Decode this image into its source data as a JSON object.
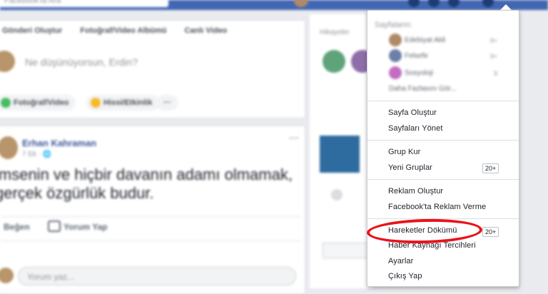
{
  "topbar": {
    "search_placeholder": "Facebook'ta Ara"
  },
  "composer": {
    "tabs": [
      "Gönderi Oluştur",
      "Fotoğraf/Video Albümü",
      "Canlı Video"
    ],
    "placeholder": "Ne düşünüyorsun, Erdin?",
    "buttons": [
      "Fotoğraf/Video",
      "Hissi/Etkinlik",
      "···"
    ]
  },
  "post": {
    "author": "Erhan Kahraman",
    "meta": "7 Ek · 🌐",
    "text_line1": "imsenin ve hiçbir davanın adamı olmamak,",
    "text_line2": "gerçek özgürlük budur.",
    "actions": [
      "Beğen",
      "Yorum Yap"
    ],
    "comment_placeholder": "Yorum yaz..."
  },
  "right_col": {
    "title": "Hikayeler"
  },
  "menu": {
    "section_title": "Sayfaların:",
    "accounts": [
      {
        "name": "Edebiyat Akli",
        "count": "9+"
      },
      {
        "name": "Felsefe",
        "count": "9+"
      },
      {
        "name": "Sosyoloji",
        "count": "9"
      }
    ],
    "see_more": "Daha Fazlasını Gör...",
    "items": {
      "create_page": "Sayfa Oluştur",
      "manage_pages": "Sayfaları Yönet",
      "create_group": "Grup Kur",
      "new_groups": "Yeni Gruplar",
      "new_groups_badge": "20+",
      "create_ad": "Reklam Oluştur",
      "advertising": "Facebook'ta Reklam Verme",
      "activity_log": "Hareketler Dökümü",
      "activity_log_badge": "20+",
      "news_feed_prefs": "Haber Kaynağı Tercihleri",
      "settings": "Ayarlar",
      "logout": "Çıkış Yap"
    }
  },
  "colors": {
    "brand_blue": "#4267b2",
    "highlight_red": "#e8131b"
  }
}
